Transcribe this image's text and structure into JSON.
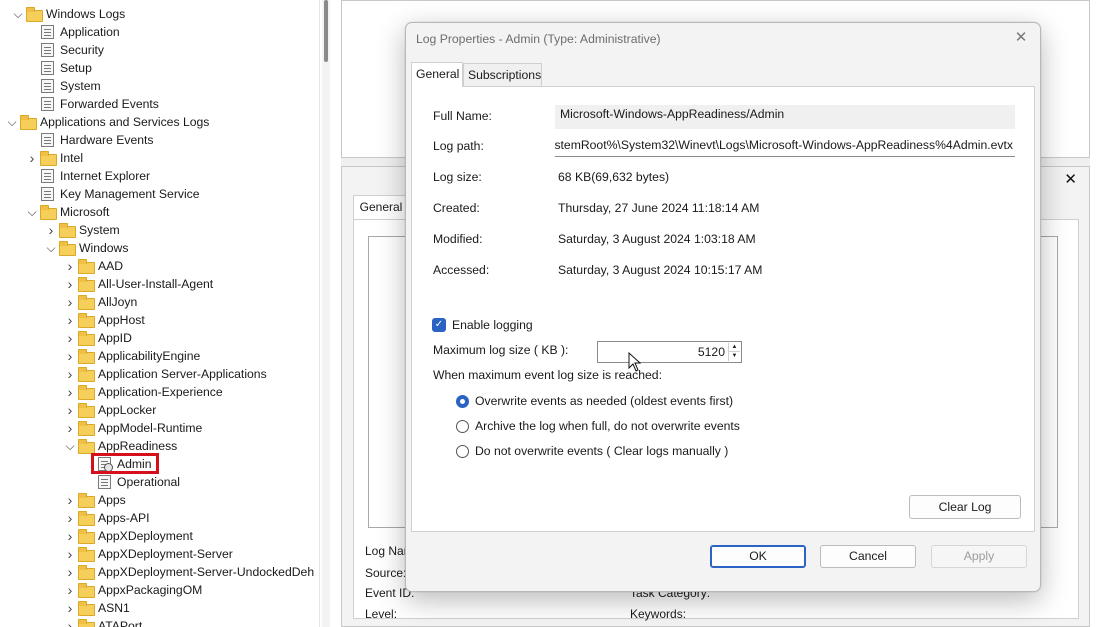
{
  "tree": {
    "items": [
      {
        "label": "Windows Logs",
        "icon": "folder-icon"
      },
      {
        "label": "Application",
        "icon": "log-icon"
      },
      {
        "label": "Security",
        "icon": "log-icon"
      },
      {
        "label": "Setup",
        "icon": "log-icon"
      },
      {
        "label": "System",
        "icon": "log-icon"
      },
      {
        "label": "Forwarded Events",
        "icon": "log-icon"
      },
      {
        "label": "Applications and Services Logs",
        "icon": "folder-icon"
      },
      {
        "label": "Hardware Events",
        "icon": "log-icon"
      },
      {
        "label": "Intel",
        "icon": "folder-icon"
      },
      {
        "label": "Internet Explorer",
        "icon": "log-icon"
      },
      {
        "label": "Key Management Service",
        "icon": "log-icon"
      },
      {
        "label": "Microsoft",
        "icon": "folder-icon"
      },
      {
        "label": "System",
        "icon": "folder-icon"
      },
      {
        "label": "Windows",
        "icon": "folder-icon"
      },
      {
        "label": "AAD",
        "icon": "folder-icon"
      },
      {
        "label": "All-User-Install-Agent",
        "icon": "folder-icon"
      },
      {
        "label": "AllJoyn",
        "icon": "folder-icon"
      },
      {
        "label": "AppHost",
        "icon": "folder-icon"
      },
      {
        "label": "AppID",
        "icon": "folder-icon"
      },
      {
        "label": "ApplicabilityEngine",
        "icon": "folder-icon"
      },
      {
        "label": "Application Server-Applications",
        "icon": "folder-icon"
      },
      {
        "label": "Application-Experience",
        "icon": "folder-icon"
      },
      {
        "label": "AppLocker",
        "icon": "folder-icon"
      },
      {
        "label": "AppModel-Runtime",
        "icon": "folder-icon"
      },
      {
        "label": "AppReadiness",
        "icon": "folder-icon"
      },
      {
        "label": "Admin",
        "icon": "log-icon"
      },
      {
        "label": "Operational",
        "icon": "log-icon"
      },
      {
        "label": "Apps",
        "icon": "folder-icon"
      },
      {
        "label": "Apps-API",
        "icon": "folder-icon"
      },
      {
        "label": "AppXDeployment",
        "icon": "folder-icon"
      },
      {
        "label": "AppXDeployment-Server",
        "icon": "folder-icon"
      },
      {
        "label": "AppXDeployment-Server-UndockedDeh",
        "icon": "folder-icon"
      },
      {
        "label": "AppxPackagingOM",
        "icon": "folder-icon"
      },
      {
        "label": "ASN1",
        "icon": "folder-icon"
      },
      {
        "label": "ATAPort",
        "icon": "folder-icon"
      }
    ]
  },
  "background_pane": {
    "tab_label": "General",
    "close_glyph": "✕",
    "labels": {
      "log_name": "Log Nar",
      "source": "Source:",
      "event_id": "Event ID:",
      "level": "Level:",
      "task_category": "Task Category:",
      "keywords": "Keywords:"
    }
  },
  "dialog": {
    "title": "Log Properties - Admin (Type: Administrative)",
    "close_glyph": "✕",
    "tabs": [
      "General",
      "Subscriptions"
    ],
    "fields": {
      "full_name_label": "Full Name:",
      "full_name_value": "Microsoft-Windows-AppReadiness/Admin",
      "log_path_label": "Log path:",
      "log_path_value": "stemRoot%\\System32\\Winevt\\Logs\\Microsoft-Windows-AppReadiness%4Admin.evtx",
      "log_size_label": "Log size:",
      "log_size_value": "68 KB(69,632 bytes)",
      "created_label": "Created:",
      "created_value": "Thursday, 27 June 2024 11:18:14 AM",
      "modified_label": "Modified:",
      "modified_value": "Saturday, 3 August 2024 1:03:18 AM",
      "accessed_label": "Accessed:",
      "accessed_value": "Saturday, 3 August 2024 10:15:17 AM"
    },
    "enable_logging": {
      "label": "Enable logging",
      "checked": true
    },
    "max_size": {
      "label": "Maximum log size ( KB ):",
      "value": "5120"
    },
    "when_max_label": "When maximum event log size is reached:",
    "options": [
      {
        "label": "Overwrite events as needed (oldest events first)",
        "checked": true
      },
      {
        "label": "Archive the log when full, do not overwrite events",
        "checked": false
      },
      {
        "label": "Do not overwrite events ( Clear logs manually )",
        "checked": false
      }
    ],
    "buttons": {
      "clear_log": "Clear Log",
      "ok": "OK",
      "cancel": "Cancel",
      "apply": "Apply"
    }
  },
  "colors": {
    "accent": "#2a63c3",
    "highlight_border": "#d6101a"
  }
}
